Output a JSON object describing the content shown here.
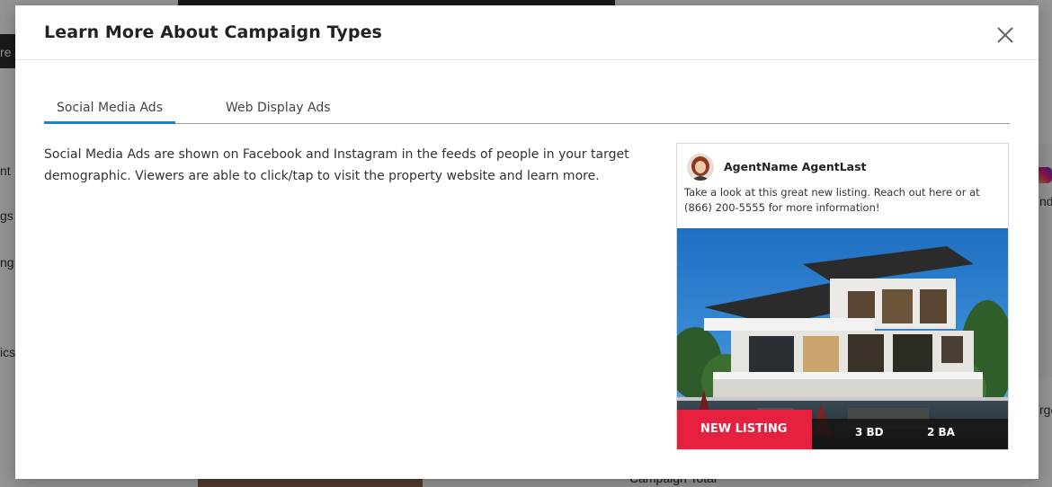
{
  "background": {
    "side_fragments": [
      "re",
      "nt",
      "gs",
      "ng",
      "ics"
    ],
    "right_fragments": [
      "nd",
      "rge"
    ],
    "bottom_text": "Campaign Total"
  },
  "modal": {
    "title": "Learn More About Campaign Types",
    "close_icon": "close-icon",
    "tabs": [
      {
        "label": "Social Media Ads",
        "active": true
      },
      {
        "label": "Web Display Ads",
        "active": false
      }
    ],
    "description": "Social Media Ads are shown on Facebook and Instagram in the feeds of people in your target demographic. Viewers are able to click/tap to visit the property website and learn more.",
    "ad_preview": {
      "agent_name": "AgentName AgentLast",
      "post_text": "Take a look at this great new listing. Reach out here or at (866) 200-5555 for more information!",
      "badge": "NEW LISTING",
      "beds": "3 BD",
      "baths": "2 BA"
    }
  },
  "colors": {
    "tab_active_underline": "#1f7fc8",
    "badge_red": "#e8203f",
    "overlay": "rgba(0,0,0,0.42)"
  }
}
